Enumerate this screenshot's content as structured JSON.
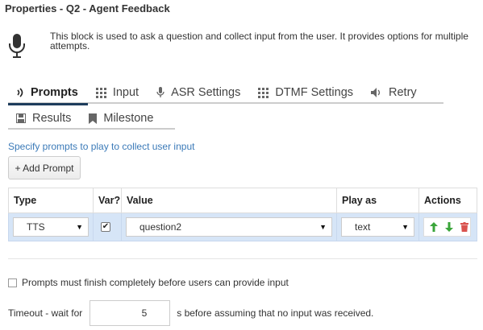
{
  "title": "Properties - Q2 - Agent Feedback",
  "description": "This block is used to ask a question and collect input from the user. It provides options for multiple attempts.",
  "tabs": [
    {
      "label": "Prompts",
      "icon": "speaker-wave-icon",
      "active": true
    },
    {
      "label": "Input",
      "icon": "grid-icon",
      "active": false
    },
    {
      "label": "ASR Settings",
      "icon": "microphone-icon",
      "active": false
    },
    {
      "label": "DTMF Settings",
      "icon": "keypad-icon",
      "active": false
    },
    {
      "label": "Retry",
      "icon": "volume-icon",
      "active": false
    },
    {
      "label": "Results",
      "icon": "save-icon",
      "active": false
    },
    {
      "label": "Milestone",
      "icon": "bookmark-icon",
      "active": false
    }
  ],
  "prompts": {
    "hint": "Specify prompts to play to collect user input",
    "add_label": "+ Add Prompt",
    "columns": [
      "Type",
      "Var?",
      "Value",
      "Play as",
      "Actions"
    ],
    "rows": [
      {
        "type": "TTS",
        "var_checked": true,
        "value": "question2",
        "play_as": "text"
      }
    ]
  },
  "options": {
    "prompts_must_finish": "Prompts must finish completely before users can provide input",
    "prompts_must_finish_checked": false,
    "timeout_prefix": "Timeout - wait for",
    "timeout_value": "5",
    "timeout_suffix": "s before assuming that no input was received."
  },
  "colors": {
    "accent": "#3b7ab8",
    "active_tab_underline": "#1d3c5c",
    "row_highlight": "#d6e5f7",
    "move_arrows": "#3aa53a",
    "delete": "#d9534f"
  }
}
